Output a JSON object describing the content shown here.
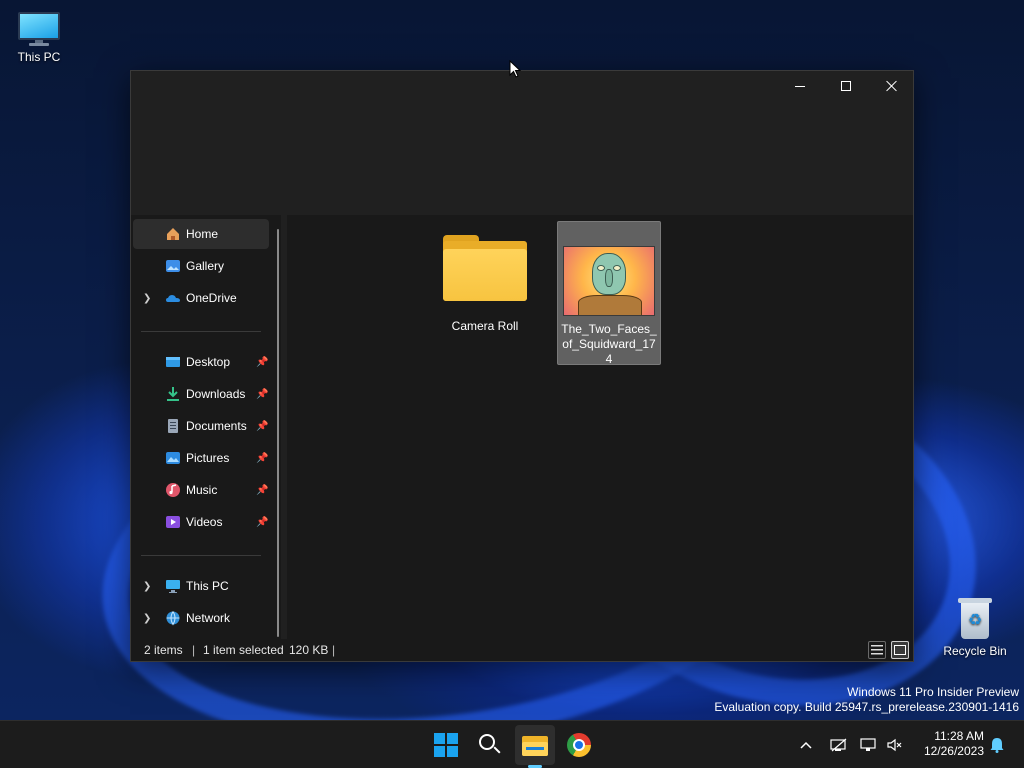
{
  "desktop": {
    "icons": [
      {
        "label": "This PC"
      },
      {
        "label": "Recycle Bin"
      }
    ]
  },
  "window": {
    "controls": {
      "minimize": "minimize",
      "maximize": "maximize",
      "close": "close"
    },
    "nav": {
      "items": [
        {
          "label": "Home",
          "icon": "home-icon",
          "active": true
        },
        {
          "label": "Gallery",
          "icon": "gallery-icon"
        },
        {
          "label": "OneDrive",
          "icon": "onedrive-icon",
          "expandable": true
        },
        {
          "label": "Desktop",
          "icon": "desktop-folder-icon",
          "pinned": true
        },
        {
          "label": "Downloads",
          "icon": "downloads-icon",
          "pinned": true
        },
        {
          "label": "Documents",
          "icon": "documents-icon",
          "pinned": true
        },
        {
          "label": "Pictures",
          "icon": "pictures-icon",
          "pinned": true
        },
        {
          "label": "Music",
          "icon": "music-icon",
          "pinned": true
        },
        {
          "label": "Videos",
          "icon": "videos-icon",
          "pinned": true
        },
        {
          "label": "This PC",
          "icon": "this-pc-icon",
          "expandable": true
        },
        {
          "label": "Network",
          "icon": "network-icon",
          "expandable": true
        }
      ]
    },
    "content": {
      "items": [
        {
          "name": "Camera Roll",
          "type": "folder",
          "selected": false
        },
        {
          "name": "The_Two_Faces_of_Squidward_174",
          "name_lines": [
            "The_Two_Faces_",
            "of_Squidward_17",
            "4"
          ],
          "type": "image",
          "selected": true
        }
      ]
    },
    "status": {
      "items_count": "2 items",
      "selection": "1 item selected",
      "size": "120 KB"
    }
  },
  "watermark": {
    "line1": "Windows 11 Pro Insider Preview",
    "line2": "Evaluation copy. Build 25947.rs_prerelease.230901-1416"
  },
  "taskbar": {
    "apps": [
      "start-icon",
      "search-icon",
      "file-explorer-icon",
      "chrome-icon"
    ],
    "clock": {
      "time": "11:28 AM",
      "date": "12/26/2023"
    }
  },
  "colors": {
    "accent": "#60cdff",
    "window_bg": "#191919",
    "titlebar_bg": "#202020",
    "taskbar_bg": "#1c1c1c",
    "selection_bg": "#616161",
    "folder": "#ffd35a"
  }
}
